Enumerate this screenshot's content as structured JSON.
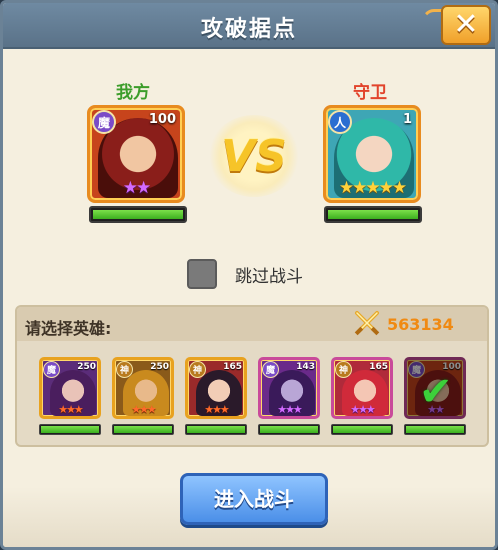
{
  "dialog": {
    "title": "攻破据点",
    "close_label": "✕"
  },
  "our_side": {
    "label": "我方",
    "faction": "魔",
    "level": "100",
    "stars": "★★",
    "hp_pct": 100
  },
  "guard_side": {
    "label": "守卫",
    "faction": "人",
    "level": "1",
    "stars": "★★★★★",
    "hp_pct": 100
  },
  "vs_text": "VS",
  "skip_battle": {
    "label": "跳过战斗",
    "checked": false
  },
  "hero_select": {
    "label": "请选择英雄:",
    "power_value": "563134",
    "heroes": [
      {
        "faction": "魔",
        "level": "250",
        "stars": "★★★",
        "star_color": "red",
        "hp_pct": 100,
        "selected": false
      },
      {
        "faction": "神",
        "level": "250",
        "stars": "★★★",
        "star_color": "red",
        "hp_pct": 100,
        "selected": false
      },
      {
        "faction": "神",
        "level": "165",
        "stars": "★★★",
        "star_color": "red",
        "hp_pct": 100,
        "selected": false
      },
      {
        "faction": "魔",
        "level": "143",
        "stars": "★★★",
        "star_color": "purple",
        "hp_pct": 100,
        "selected": false
      },
      {
        "faction": "神",
        "level": "165",
        "stars": "★★★",
        "star_color": "purple",
        "hp_pct": 100,
        "selected": false
      },
      {
        "faction": "魔",
        "level": "100",
        "stars": "★★",
        "star_color": "purple",
        "hp_pct": 100,
        "selected": true
      }
    ]
  },
  "enter_battle_label": "进入战斗",
  "colors": {
    "title_bar": "#6f8aa2",
    "our_label": "#3c9d2a",
    "guard_label": "#e2442c",
    "hp_green": "#5ac534",
    "power_orange": "#f08a12",
    "enter_button": "#4b8fe8"
  }
}
